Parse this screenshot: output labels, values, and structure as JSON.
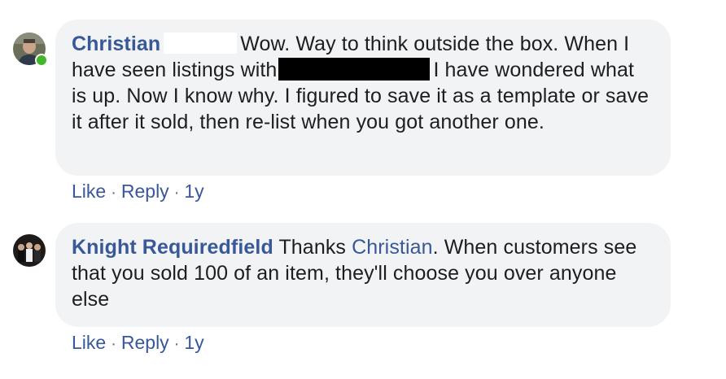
{
  "comments": [
    {
      "author": "Christian",
      "text_part1": "Wow. Way to think outside the box. When I have seen listings with",
      "text_part2": "I have wondered what is up. Now I know why. I figured to save it as a template or save it after it sold, then re-list when you got another one.",
      "online": true,
      "actions": {
        "like": "Like",
        "reply": "Reply",
        "sep": "·",
        "time": "1y"
      }
    },
    {
      "author": "Knight Requiredfield",
      "text_prefix": "Thanks",
      "mention": "Christian",
      "text_rest": ". When customers see that you sold 100 of an item, they'll choose you over anyone else",
      "online": false,
      "actions": {
        "like": "Like",
        "reply": "Reply",
        "sep": "·",
        "time": "1y"
      }
    }
  ],
  "colors": {
    "link": "#385898",
    "bubble": "#f2f3f5",
    "online": "#42b72a"
  }
}
